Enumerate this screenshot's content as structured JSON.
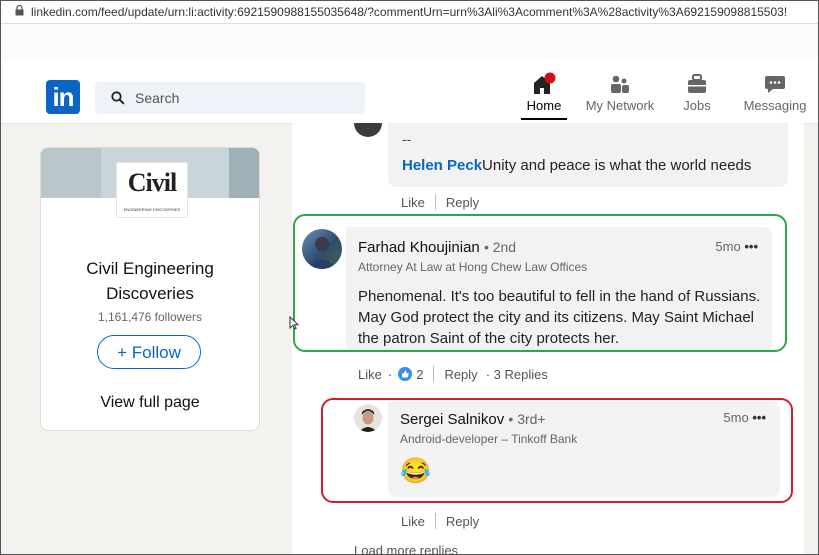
{
  "browser": {
    "url": "linkedin.com/feed/update/urn:li:activity:6921590988155035648/?commentUrn=urn%3Ali%3Acomment%3A%28activity%3A692159098815503!"
  },
  "header": {
    "search_placeholder": "Search",
    "nav": [
      {
        "label": "Home",
        "icon": "home-icon",
        "active": true
      },
      {
        "label": "My Network",
        "icon": "network-icon"
      },
      {
        "label": "Jobs",
        "icon": "briefcase-icon"
      },
      {
        "label": "Messaging",
        "icon": "messaging-icon"
      }
    ]
  },
  "company": {
    "logo_text": "Civil",
    "logo_subtext": "ENGINEERING DISCOVERIES",
    "name_line1": "Civil Engineering",
    "name_line2": "Discoveries",
    "followers": "1,161,476 followers",
    "follow_label": "+ Follow",
    "view_page": "View full page"
  },
  "comments": {
    "prev": {
      "dash": "--",
      "mention": "Helen Peck",
      "text": "Unity and peace is what the world needs",
      "like": "Like",
      "reply": "Reply"
    },
    "main": {
      "name": "Farhad Khoujinian",
      "degree": "• 2nd",
      "headline": "Attorney At Law at Hong Chew Law Offices",
      "time": "5mo",
      "more": "•••",
      "text": "Phenomenal. It's too beautiful to fell in the hand of Russians. May God protect the city and its citizens. May Saint Michael the patron Saint of the city protects her.",
      "like": "Like",
      "dot": "·",
      "reactions": "2",
      "reply": "Reply",
      "replies": "· 3 Replies"
    },
    "reply": {
      "name": "Sergei Salnikov",
      "degree": "• 3rd+",
      "headline": "Android-developer – Tinkoff Bank",
      "time": "5mo",
      "more": "•••",
      "emoji": "😂",
      "like": "Like",
      "reply": "Reply"
    },
    "load_more": "Load more replies"
  },
  "colors": {
    "brand": "#0a66c2",
    "green_highlight": "#2ea84a",
    "red_highlight": "#d0202e"
  }
}
